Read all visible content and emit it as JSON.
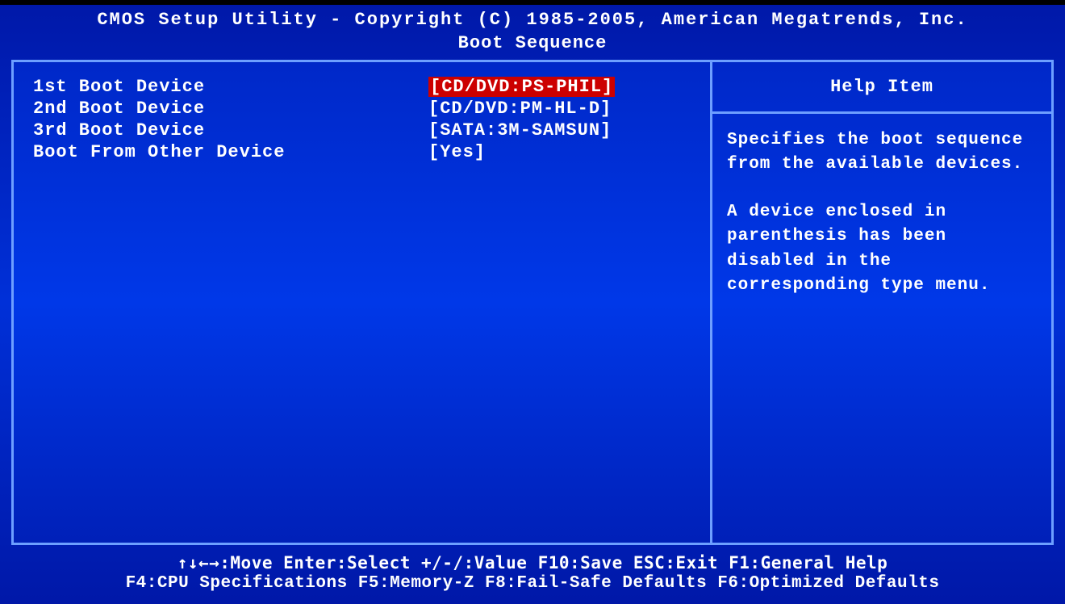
{
  "header": {
    "title": "CMOS Setup Utility - Copyright (C) 1985-2005, American Megatrends, Inc.",
    "page": "Boot Sequence"
  },
  "options": [
    {
      "label": "1st Boot Device",
      "value": "[CD/DVD:PS-PHIL]",
      "selected": true
    },
    {
      "label": "2nd Boot Device",
      "value": "[CD/DVD:PM-HL-D]",
      "selected": false
    },
    {
      "label": "3rd Boot Device",
      "value": "[SATA:3M-SAMSUN]",
      "selected": false
    },
    {
      "label": "Boot From Other Device",
      "value": "[Yes]",
      "selected": false
    }
  ],
  "help": {
    "title": "Help Item",
    "para1": "Specifies the boot sequence from the available devices.",
    "para2": "A device enclosed in parenthesis has been disabled in the corresponding type menu."
  },
  "footer": {
    "line1": "↑↓←→:Move   Enter:Select   +/-/:Value    F10:Save   ESC:Exit   F1:General Help",
    "line2": "F4:CPU Specifications F5:Memory-Z F8:Fail-Safe Defaults F6:Optimized Defaults"
  }
}
